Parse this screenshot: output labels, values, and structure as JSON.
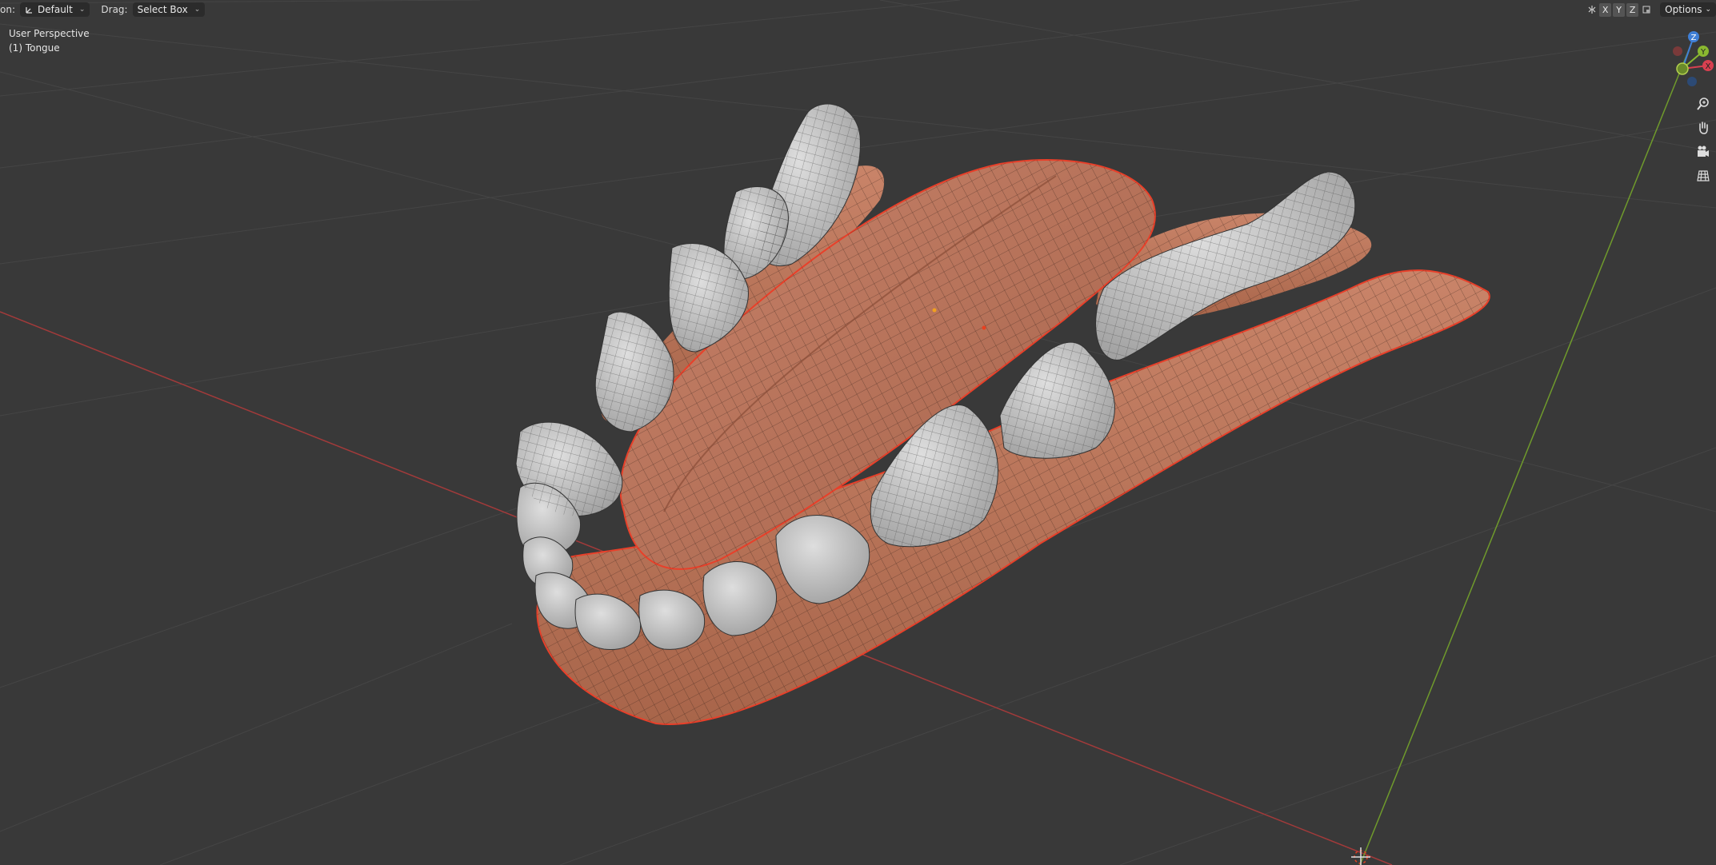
{
  "header": {
    "orientation_label": "on:",
    "orientation_value": "Default",
    "drag_label": "Drag:",
    "drag_value": "Select Box",
    "axis_buttons": [
      "X",
      "Y",
      "Z"
    ],
    "options_label": "Options"
  },
  "overlay": {
    "view_name": "User Perspective",
    "object_name": "(1) Tongue"
  },
  "gizmo": {
    "z_label": "Z",
    "y_label": "Y",
    "x_label": "X"
  },
  "colors": {
    "background": "#393939",
    "grid": "#4a4a4a",
    "axis_x": "#b03a3a",
    "axis_y": "#6d9a2a",
    "gum": "#c07a5c",
    "tooth": "#c9c9c9",
    "selection_outline": "#e8402a"
  },
  "icons": {
    "zoom": "zoom-icon",
    "pan": "hand-pan-icon",
    "camera": "camera-icon",
    "ortho": "grid-ortho-icon"
  }
}
